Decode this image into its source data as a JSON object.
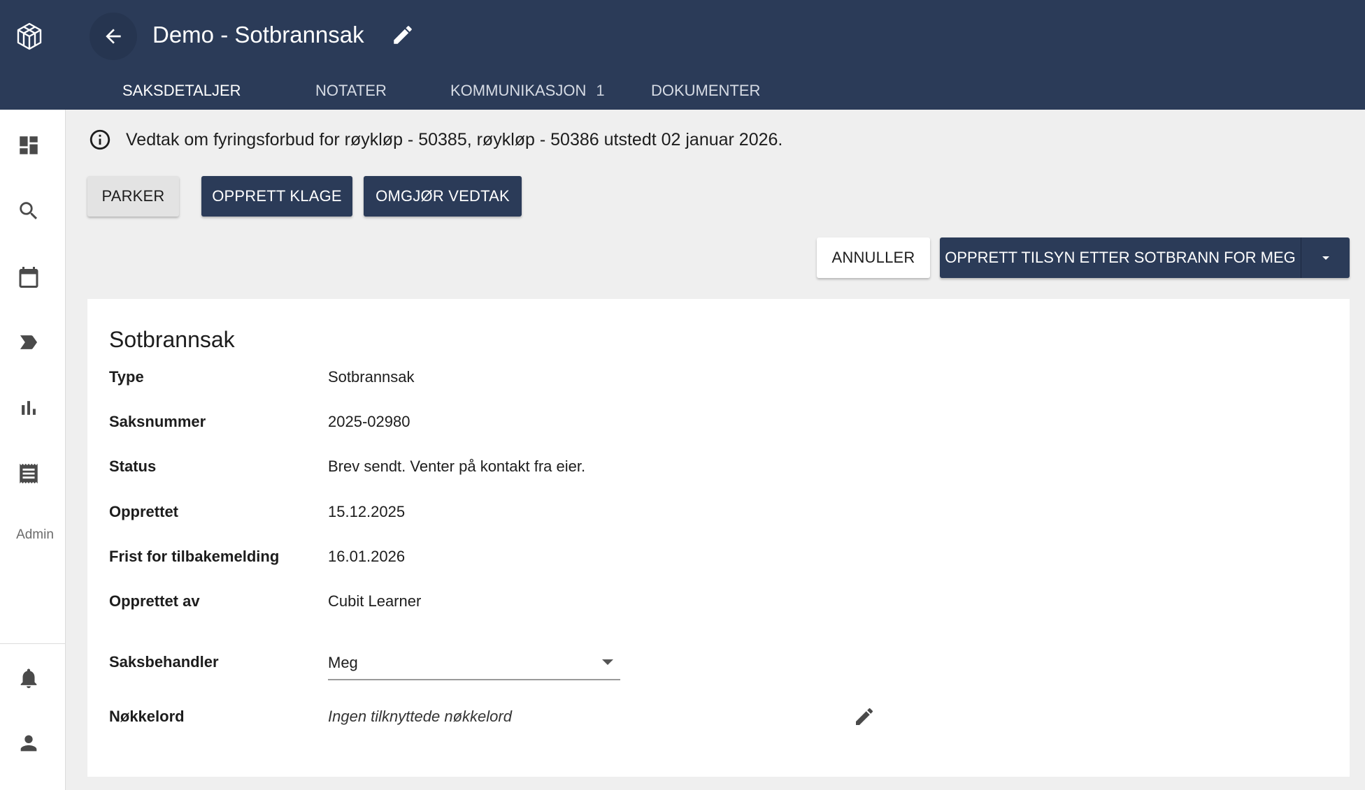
{
  "header": {
    "title": "Demo - Sotbrannsak",
    "tabs": [
      {
        "label": "SAKSDETALJER",
        "badge": ""
      },
      {
        "label": "NOTATER",
        "badge": ""
      },
      {
        "label": "KOMMUNIKASJON",
        "badge": "1"
      },
      {
        "label": "DOKUMENTER",
        "badge": ""
      }
    ],
    "active_tab": "SAKSDETALJER"
  },
  "sidebar": {
    "icons": [
      "dashboard-icon",
      "search-icon",
      "calendar-icon",
      "label-icon",
      "bar-chart-icon",
      "receipt-icon",
      "bell-icon",
      "person-icon"
    ],
    "admin_label": "Admin"
  },
  "info": {
    "message": "Vedtak om fyringsforbud for røykløp - 50385, røykløp - 50386 utstedt 02 januar 2026."
  },
  "actions": {
    "parker": "PARKER",
    "opprett_klage": "OPPRETT KLAGE",
    "omgjor_vedtak": "OMGJØR VEDTAK",
    "annuller": "ANNULLER",
    "opprett_tilsyn": "OPPRETT TILSYN ETTER SOTBRANN FOR MEG"
  },
  "case": {
    "heading": "Sotbrannsak",
    "fields": [
      {
        "label": "Type",
        "value": "Sotbrannsak"
      },
      {
        "label": "Saksnummer",
        "value": "2025-02980"
      },
      {
        "label": "Status",
        "value": "Brev sendt. Venter på kontakt fra eier."
      },
      {
        "label": "Opprettet",
        "value": "15.12.2025"
      },
      {
        "label": "Frist for tilbakemelding",
        "value": "16.01.2026"
      },
      {
        "label": "Opprettet av",
        "value": "Cubit Learner"
      }
    ],
    "saksbehandler_label": "Saksbehandler",
    "saksbehandler_value": "Meg",
    "nokkelord_label": "Nøkkelord",
    "nokkelord_value": "Ingen tilknyttede nøkkelord"
  },
  "colors": {
    "header_bg": "#2b3b58",
    "primary_button": "#2b3b58",
    "page_bg": "#efefef"
  }
}
